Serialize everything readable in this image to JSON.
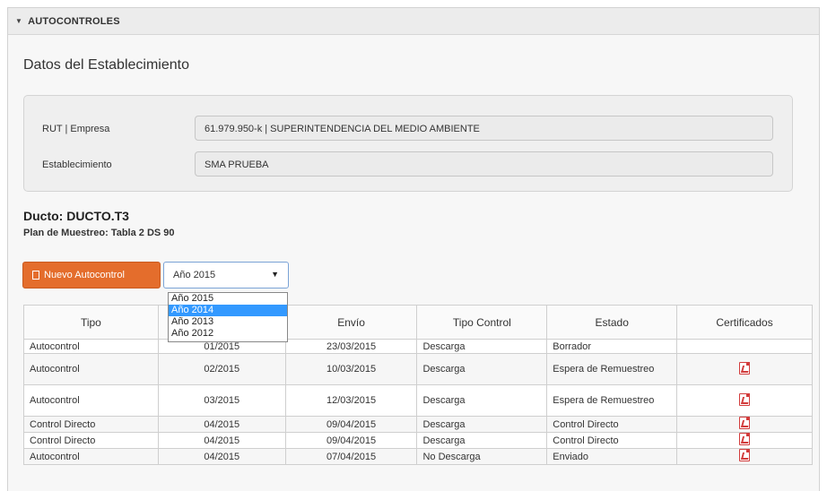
{
  "section": {
    "title": "AUTOCONTROLES"
  },
  "establecimiento": {
    "title": "Datos del Establecimiento",
    "fields": [
      {
        "label": "RUT | Empresa",
        "value": "61.979.950-k | SUPERINTENDENCIA DEL MEDIO AMBIENTE"
      },
      {
        "label": "Establecimiento",
        "value": "SMA PRUEBA"
      }
    ]
  },
  "ducto": {
    "title": "Ducto: DUCTO.T3",
    "plan": "Plan de Muestreo: Tabla 2 DS 90"
  },
  "toolbar": {
    "new_button": "Nuevo Autocontrol",
    "year_selected": "Año 2015",
    "year_options": [
      "Año 2015",
      "Año 2014",
      "Año 2013",
      "Año 2012"
    ],
    "highlighted_option": "Año 2014"
  },
  "table": {
    "headers": [
      "Tipo",
      "",
      "Envío",
      "Tipo Control",
      "Estado",
      "Certificados"
    ],
    "rows": [
      {
        "tipo": "Autocontrol",
        "periodo": "01/2015",
        "envio": "23/03/2015",
        "control": "Descarga",
        "estado": "Borrador",
        "cert": false
      },
      {
        "tipo": "Autocontrol",
        "periodo": "02/2015",
        "envio": "10/03/2015",
        "control": "Descarga",
        "estado": "Espera de Remuestreo",
        "cert": true
      },
      {
        "tipo": "Autocontrol",
        "periodo": "03/2015",
        "envio": "12/03/2015",
        "control": "Descarga",
        "estado": "Espera de Remuestreo",
        "cert": true
      },
      {
        "tipo": "Control Directo",
        "periodo": "04/2015",
        "envio": "09/04/2015",
        "control": "Descarga",
        "estado": "Control Directo",
        "cert": true
      },
      {
        "tipo": "Control Directo",
        "periodo": "04/2015",
        "envio": "09/04/2015",
        "control": "Descarga",
        "estado": "Control Directo",
        "cert": true
      },
      {
        "tipo": "Autocontrol",
        "periodo": "04/2015",
        "envio": "07/04/2015",
        "control": "No Descarga",
        "estado": "Enviado",
        "cert": true
      }
    ]
  },
  "colors": {
    "accent": "#e46d2c",
    "highlight": "#3399ff",
    "pdf": "#d23c3c"
  }
}
